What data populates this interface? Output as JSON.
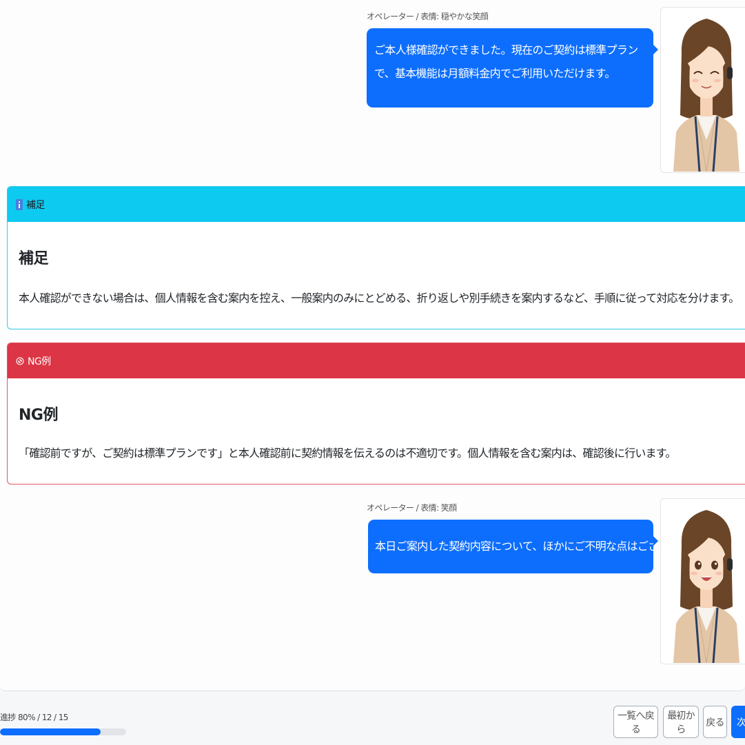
{
  "conversation": [
    {
      "speaker_meta": "オペレーター / 表情: 穏やかな笑顔",
      "message": "ご本人様確認ができました。現在のご契約は標準プランで、基本機能は月額料金内でご利用いただけます。",
      "expression": "closed-eye-smile"
    },
    {
      "speaker_meta": "オペレーター / 表情: 笑顔",
      "message": "本日ご案内した契約内容について、ほかにご不明な点はございますでしょうか。",
      "expression": "open-mouth-smile"
    }
  ],
  "notes": {
    "info": {
      "header": "補足",
      "icon": "info-icon",
      "title": "補足",
      "body": "本人確認ができない場合は、個人情報を含む案内を控え、一般案内のみにとどめる、折り返しや別手続きを案内するなど、手順に従って対応を分けます。"
    },
    "ng": {
      "header": "NG例",
      "icon": "prohibited-icon",
      "title": "NG例",
      "body": "「確認前ですが、ご契約は標準プランです」と本人確認前に契約情報を伝えるのは不適切です。個人情報を含む案内は、確認後に行います。"
    }
  },
  "progress": {
    "label": "進捗 80% / 12 / 15",
    "fraction": 0.8
  },
  "nav": {
    "list_label": "一覧へ戻る",
    "first_label": "最初から",
    "back_label": "戻る",
    "next_label": "次"
  },
  "colors": {
    "primary": "#0d6efd",
    "info": "#0dcaf0",
    "danger": "#dc3545"
  }
}
